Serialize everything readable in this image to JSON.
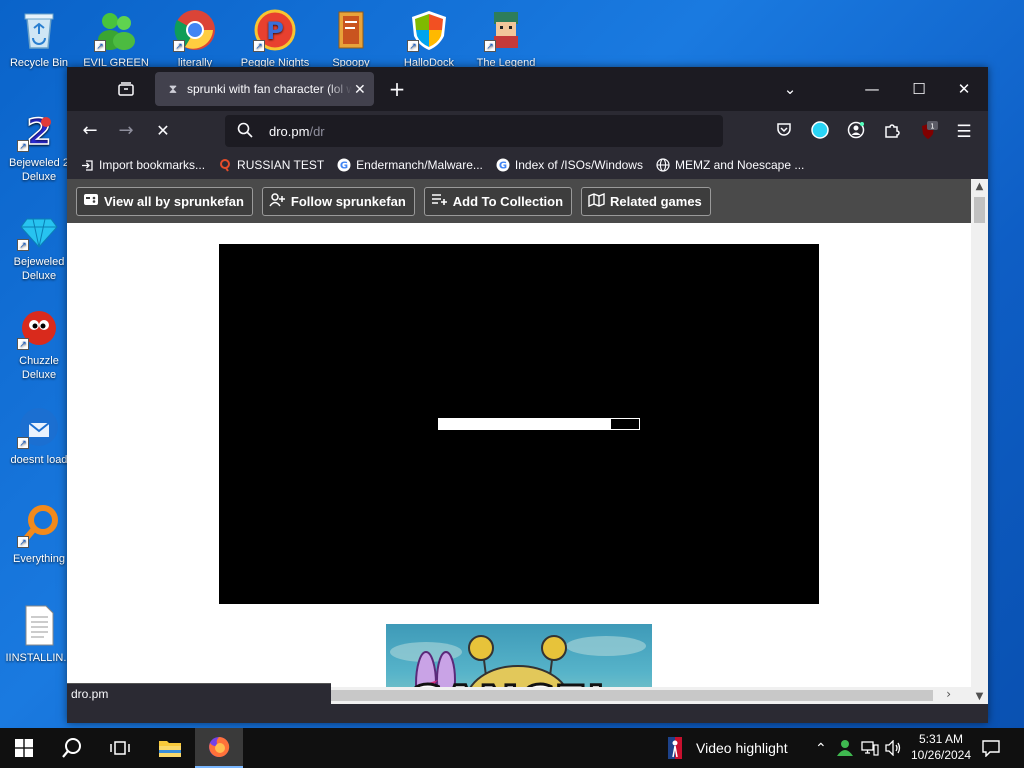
{
  "desktop": {
    "icons": [
      {
        "label": "Recycle Bin"
      },
      {
        "label": "EVIL GREEN"
      },
      {
        "label": "literally"
      },
      {
        "label": "Peggle Nights"
      },
      {
        "label": "Spoopy"
      },
      {
        "label": "HalloDock"
      },
      {
        "label": "The Legend"
      },
      {
        "label": "Bejeweled 2 Deluxe"
      },
      {
        "label": "Bejeweled Deluxe"
      },
      {
        "label": "Chuzzle Deluxe"
      },
      {
        "label": "doesnt load"
      },
      {
        "label": "Everything"
      },
      {
        "label": "IINSTALLIN..."
      }
    ]
  },
  "browser": {
    "tab": {
      "title": "sprunki with fan character (lol w"
    },
    "url": {
      "host": "dro.pm",
      "path": "/dr"
    },
    "extensions_badge": "1",
    "bookmarks": [
      {
        "label": "Import bookmarks...",
        "icon": "import-icon"
      },
      {
        "label": "RUSSIAN TEST",
        "icon": "search-icon"
      },
      {
        "label": "Endermanch/Malware...",
        "icon": "google-icon"
      },
      {
        "label": "Index of /ISOs/Windows",
        "icon": "google-icon"
      },
      {
        "label": "MEMZ and Noescape ...",
        "icon": "globe-icon"
      }
    ],
    "status_text": "dro.pm"
  },
  "itch": {
    "buttons": [
      {
        "label": "View all by sprunkefan",
        "icon": "gamepad-icon"
      },
      {
        "label": "Follow sprunkefan",
        "icon": "user-plus-icon"
      },
      {
        "label": "Add To Collection",
        "icon": "add-list-icon"
      },
      {
        "label": "Related games",
        "icon": "map-icon"
      }
    ],
    "loading_progress": 0.86,
    "thumbnail_text": "CANCEL"
  },
  "taskbar": {
    "news_text": "Video highlight",
    "time": "5:31 AM",
    "date": "10/26/2024"
  }
}
